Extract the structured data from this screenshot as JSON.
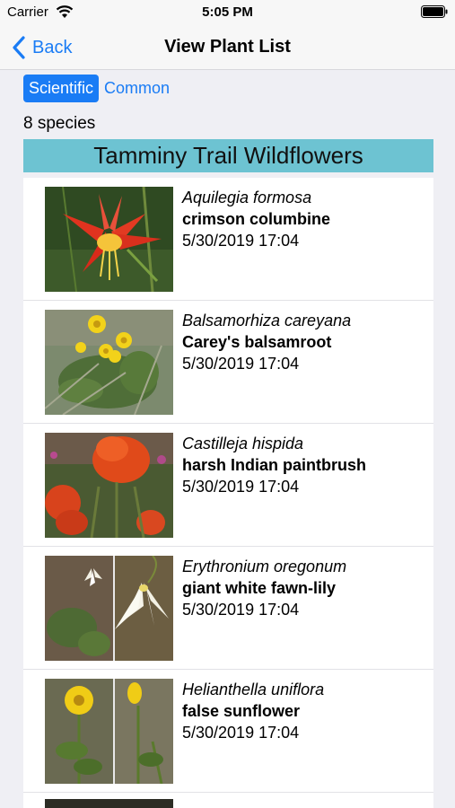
{
  "status": {
    "carrier": "Carrier",
    "time": "5:05 PM"
  },
  "nav": {
    "back_label": "Back",
    "title": "View Plant List"
  },
  "toggle": {
    "scientific_label": "Scientific",
    "common_label": "Common",
    "selected": "Scientific"
  },
  "species_count": "8 species",
  "list_title": "Tamminy Trail Wildflowers",
  "items": [
    {
      "scientific": "Aquilegia formosa",
      "common": "crimson columbine",
      "date": "5/30/2019 17:04",
      "photo": "columbine-photo"
    },
    {
      "scientific": "Balsamorhiza careyana",
      "common": "Carey's balsamroot",
      "date": "5/30/2019 17:04",
      "photo": "balsamroot-photo"
    },
    {
      "scientific": "Castilleja hispida",
      "common": "harsh Indian paintbrush",
      "date": "5/30/2019 17:04",
      "photo": "paintbrush-photo"
    },
    {
      "scientific": "Erythronium oregonum",
      "common": "giant white fawn-lily",
      "date": "5/30/2019 17:04",
      "photo": "fawn-lily-photo"
    },
    {
      "scientific": "Helianthella uniflora",
      "common": "false sunflower",
      "date": "5/30/2019 17:04",
      "photo": "false-sunflower-photo"
    }
  ],
  "colors": {
    "accent": "#1a7cf5",
    "header_bg": "#6dc3d2",
    "background": "#efeff4"
  }
}
